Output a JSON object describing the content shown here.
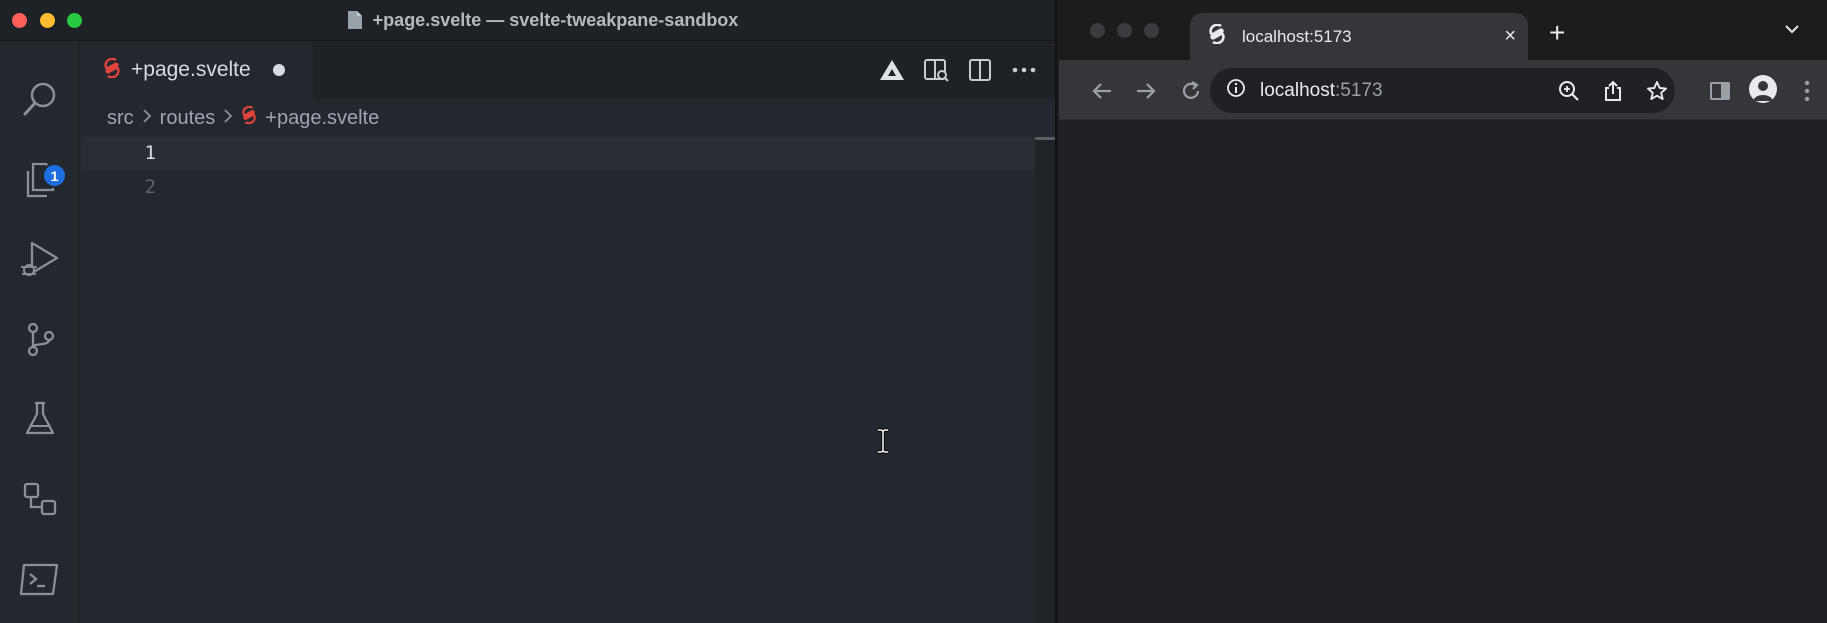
{
  "vscode": {
    "window_title": "+page.svelte — svelte-tweakpane-sandbox",
    "traffic_colors": [
      "#fe5f57",
      "#febc2e",
      "#28c840"
    ],
    "activity_bar": {
      "items": [
        {
          "name": "search-icon"
        },
        {
          "name": "explorer-files-icon",
          "badge": "1"
        },
        {
          "name": "run-debug-icon"
        },
        {
          "name": "source-control-icon"
        },
        {
          "name": "testing-flask-icon"
        },
        {
          "name": "remote-explorer-icon"
        },
        {
          "name": "terminal-icon"
        }
      ],
      "badge_color": "#1d6fe0"
    },
    "tab": {
      "label": "+page.svelte",
      "dirty": true,
      "icon": "svelte-icon"
    },
    "tab_actions": [
      "prettier-icon",
      "open-preview-icon",
      "split-editor-icon",
      "more-actions-icon"
    ],
    "breadcrumb": {
      "items": [
        "src",
        "routes",
        "+page.svelte"
      ]
    },
    "editor": {
      "line_numbers": [
        "1",
        "2"
      ],
      "active_line": "1"
    }
  },
  "browser": {
    "tab": {
      "title": "localhost:5173",
      "favicon": "svelte-icon",
      "close": "×"
    },
    "new_tab": "+",
    "omnibox": {
      "host": "localhost",
      "port": ":5173",
      "info_icon": "info-icon"
    },
    "toolbar_icons": [
      "back-arrow-icon",
      "forward-arrow-icon",
      "reload-icon",
      "zoom-icon",
      "share-icon",
      "bookmark-star-icon",
      "side-panel-icon",
      "profile-icon",
      "menu-kebab-icon"
    ]
  },
  "colors": {
    "svelte_accent": "#e0443a",
    "editor_bg": "#23272e",
    "browser_bg": "#202124"
  }
}
